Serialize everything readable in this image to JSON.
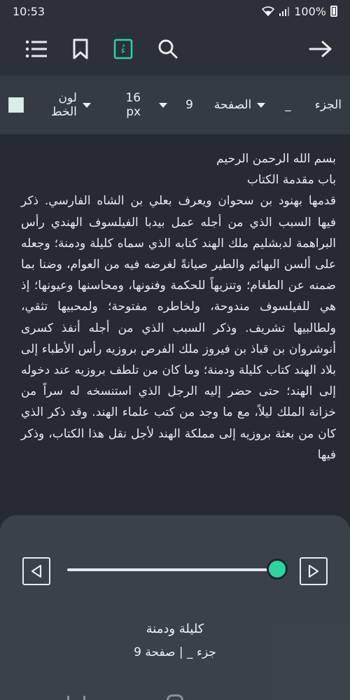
{
  "status": {
    "time": "10:53",
    "battery": "100%"
  },
  "toolbar": {
    "menu_icon": "list-icon",
    "bookmark_icon": "bookmark-icon",
    "tashkeel_icon": "tashkeel-icon",
    "tashkeel_glyph": "ءُ",
    "search_icon": "search-icon",
    "forward_icon": "arrow-right-icon",
    "accent": "#2ed39e"
  },
  "settings": {
    "part_label": "الجزء",
    "part_value": "_",
    "page_label": "الصفحة",
    "page_value": "9",
    "font_size": "16 px",
    "font_color_label": "لون الخط",
    "font_color": "#d9efe6"
  },
  "content": {
    "lines": [
      "بسم الله الرحمن الرحيم",
      "باب مقدمة الكتاب",
      "قدمها بهنود بن سحوان ويعرف بعلي بن الشاه الفارسي. ذكر فيها السبب الذي من أجله عمل بيدبا الفيلسوف الهندي رأس البراهمة لدبشليم ملك الهند كتابه الذي سماه كليلة ودمنة؛ وجعله على ألسن البهائم والطير صيانةً لغرضه فيه من العوام، وضنا بما ضمنه عن الطغام؛ وتنزيهاً للحكمة وفنونها، ومحاسنها وعيونها؛ إذ هي للفيلسوف مندوحة، ولخاطره مفتوحة؛ ولمحبيها تثقي، ولطالبيها تشريف. وذكر السبب الذي من أجله أنفذ كسرى أنوشروان بن قباذ بن فيروز ملك الفرص بروزيه رأس الأطباء إلى بلاد الهند كتاب كليلة ودمنة؛ وما كان من تلطف بروزيه عند دخوله إلى الهند؛ حتى حضر إليه الرجل الذي استنسخه له سراً من خزانة الملك ليلاً، مع ما وجد من كتب علماء الهند. وقد ذكر الذي كان من بعثة بروزيه إلى مملكة الهند لأجل نقل هذا الكتاب، وذكر فيها"
    ]
  },
  "reader": {
    "prev_icon": "triangle-left-icon",
    "next_icon": "triangle-right-icon",
    "progress": 0.98,
    "book_title": "كليلة ودمنة",
    "location": "جزء _ | صفحة 9"
  }
}
